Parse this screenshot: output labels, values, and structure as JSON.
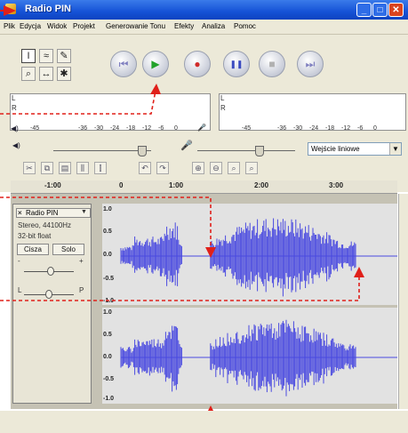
{
  "window": {
    "title": "Radio PIN",
    "min_glyph": "_",
    "max_glyph": "□",
    "close_glyph": "✕"
  },
  "menu": [
    "Plik",
    "Edycja",
    "Widok",
    "Projekt",
    "Generowanie Tonu",
    "Efekty",
    "Analiza",
    "Pomoc"
  ],
  "tools": {
    "select": "I",
    "envelope": "≈",
    "draw": "✎",
    "zoom": "⌕",
    "timeshift": "↔",
    "multi": "✱"
  },
  "transport": {
    "rewind": "⏮",
    "play": "▶",
    "record": "●",
    "pause": "❚❚",
    "stop": "■",
    "forward": "⏭"
  },
  "meters": {
    "left_channel": "L",
    "right_channel": "R",
    "scale_left": [
      "-45",
      "-36",
      "-30",
      "-24",
      "-18",
      "-12",
      "-6",
      "0"
    ],
    "scale_right": [
      "-45",
      "-36",
      "-30",
      "-24",
      "-18",
      "-12",
      "-6",
      "0"
    ]
  },
  "mixer": {
    "input_source": "Wejście liniowe"
  },
  "timeline": [
    "-1:00",
    "0",
    "1:00",
    "2:00",
    "3:00"
  ],
  "track": {
    "name": "Radio PIN",
    "format": "Stereo, 44100Hz",
    "bitdepth": "32-bit float",
    "mute_label": "Cisza",
    "solo_label": "Solo",
    "gain_minus": "-",
    "gain_plus": "+",
    "pan_left": "L",
    "pan_right": "P",
    "close_glyph": "×",
    "menu_arrow": "▼"
  },
  "waveform": {
    "yticks": [
      "1.0",
      "0.5",
      "0.0",
      "-0.5",
      "-1.0"
    ],
    "color": "#4a4ae0"
  },
  "annotation": {
    "color": "#e0201a"
  }
}
